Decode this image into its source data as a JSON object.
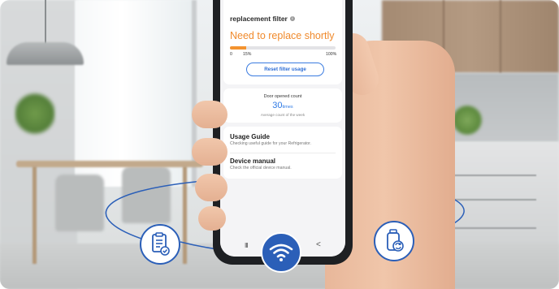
{
  "filter": {
    "title": "replacement filter",
    "info_icon": "i",
    "status": "Need to replace shortly",
    "usage_percent": 15,
    "scale_min": "0",
    "scale_mark": "15%",
    "scale_max": "100%",
    "reset_label": "Reset filter usage",
    "status_color": "#f08a2c",
    "accent_color": "#2f6fd6"
  },
  "door": {
    "title": "Door opened count",
    "count": "30",
    "unit": "times",
    "subtitle": "Average count of the week"
  },
  "menu": {
    "usage_guide_title": "Usage Guide",
    "usage_guide_sub": "Checking useful guide for your Refrigerator.",
    "device_manual_title": "Device manual",
    "device_manual_sub": "Check the official device manual."
  },
  "navbar": {
    "recent_glyph": "III",
    "back_glyph": "<"
  },
  "icons": {
    "left": "document-check-icon",
    "center": "wifi-icon",
    "right": "water-filter-refresh-icon"
  }
}
